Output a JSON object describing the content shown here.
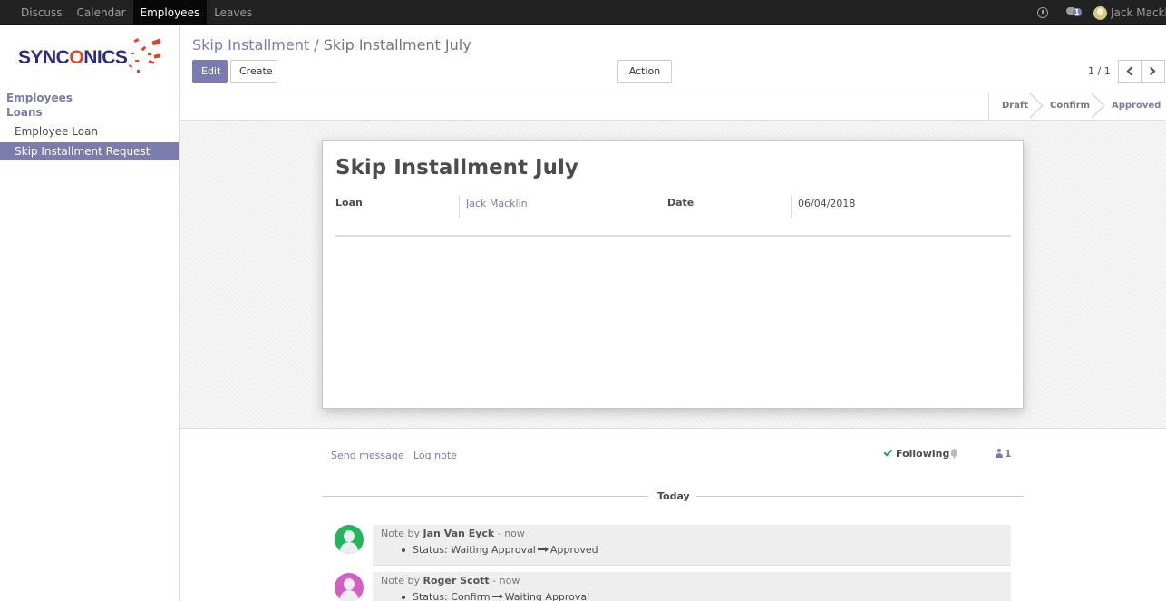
{
  "topbar": {
    "menu": [
      "Discuss",
      "Calendar",
      "Employees",
      "Leaves"
    ],
    "active_menu": "Employees",
    "chat_badge": "1",
    "user_name": "Jack Macklin"
  },
  "sidebar": {
    "logo_text_left": "SYNC",
    "logo_text_o": "O",
    "logo_text_right": "NICS",
    "sections": [
      "Employees",
      "Loans"
    ],
    "items": [
      "Employee Loan",
      "Skip Installment Request"
    ],
    "active_item": "Skip Installment Request"
  },
  "breadcrumb": {
    "parent": "Skip Installment",
    "separator": "/",
    "current": "Skip Installment July"
  },
  "toolbar": {
    "edit_label": "Edit",
    "create_label": "Create",
    "action_label": "Action"
  },
  "pager": {
    "label": "1 / 1"
  },
  "statusbar": {
    "stages": [
      "Draft",
      "Confirm",
      "Approved"
    ],
    "active": "Approved"
  },
  "form": {
    "title": "Skip Installment July",
    "loan_label": "Loan",
    "loan_value": "Jack Macklin",
    "date_label": "Date",
    "date_value": "06/04/2018"
  },
  "chatter": {
    "send_message": "Send message",
    "log_note": "Log note",
    "following": "Following",
    "followers_count": "1",
    "today": "Today",
    "messages": [
      {
        "prefix": "Note by",
        "author": "Jan Van Eyck",
        "time": "- now",
        "field": "Status:",
        "old": "Waiting Approval",
        "new": "Approved",
        "avatar_color": "#21b55c"
      },
      {
        "prefix": "Note by",
        "author": "Roger Scott",
        "time": "- now",
        "field": "Status:",
        "old": "Confirm",
        "new": "Waiting Approval",
        "avatar_color": "#d35fc3"
      }
    ]
  },
  "colors": {
    "brand": "#7c7bad",
    "navbar": "#222222",
    "logo_blue": "#2d2a88",
    "logo_orange": "#e8431f"
  }
}
